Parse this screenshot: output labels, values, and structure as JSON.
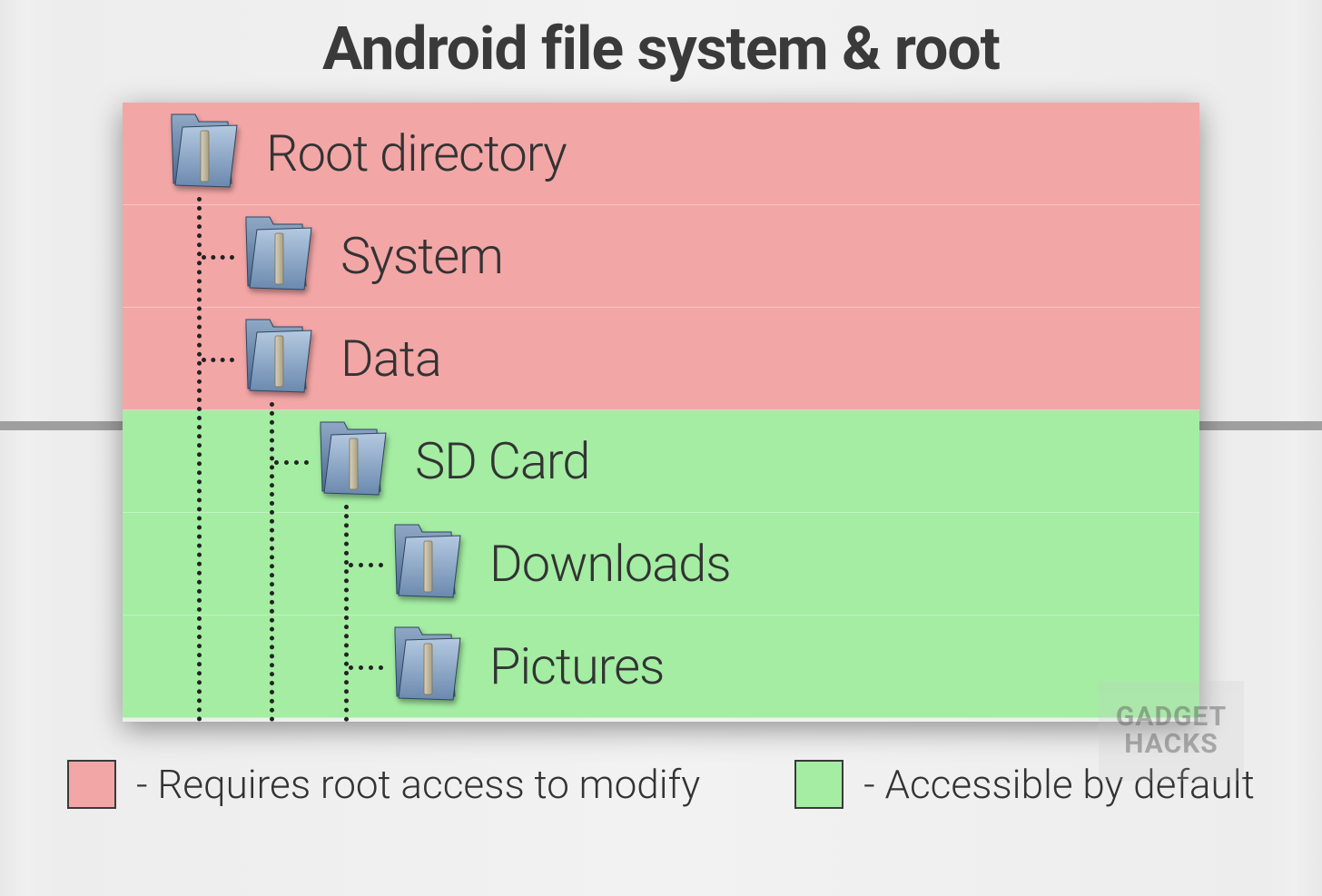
{
  "title": "Android file system & root",
  "rows": [
    {
      "label": "Root directory",
      "zone": "root",
      "indent": 0
    },
    {
      "label": "System",
      "zone": "root",
      "indent": 1
    },
    {
      "label": "Data",
      "zone": "root",
      "indent": 1
    },
    {
      "label": "SD Card",
      "zone": "user",
      "indent": 2
    },
    {
      "label": "Downloads",
      "zone": "user",
      "indent": 3
    },
    {
      "label": "Pictures",
      "zone": "user",
      "indent": 3
    }
  ],
  "legend": {
    "root_label": "- Requires root access to modify",
    "user_label": "- Accessible by default"
  },
  "watermark": {
    "line1": "GADGET",
    "line2": "HACKS"
  },
  "colors": {
    "root_zone": "#f3a6a6",
    "user_zone": "#a4eda3"
  }
}
